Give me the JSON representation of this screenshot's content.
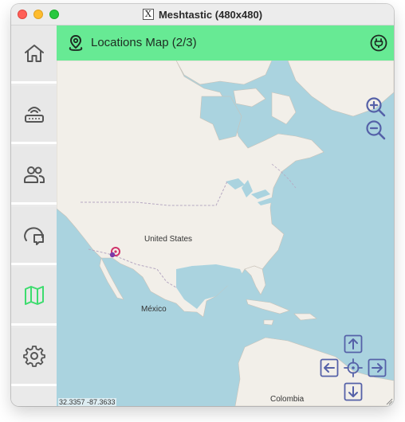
{
  "window": {
    "title": "Meshtastic (480x480)"
  },
  "sidebar": {
    "items": [
      {
        "icon": "home-icon",
        "active": false
      },
      {
        "icon": "router-icon",
        "active": false
      },
      {
        "icon": "users-icon",
        "active": false
      },
      {
        "icon": "chat-icon",
        "active": false
      },
      {
        "icon": "map-icon",
        "active": true
      },
      {
        "icon": "gear-icon",
        "active": false
      }
    ]
  },
  "topbar": {
    "title": "Locations Map (2/3)"
  },
  "map": {
    "labels": {
      "us": "United States",
      "mexico": "México",
      "colombia": "Colombia"
    },
    "coords": "32.3357 -87.3633"
  },
  "colors": {
    "accent": "#67ea94",
    "active_icon": "#3ddc6e",
    "icon": "#555555",
    "map_control": "#5561a8",
    "water": "#aad3df",
    "land": "#f2efe9"
  }
}
